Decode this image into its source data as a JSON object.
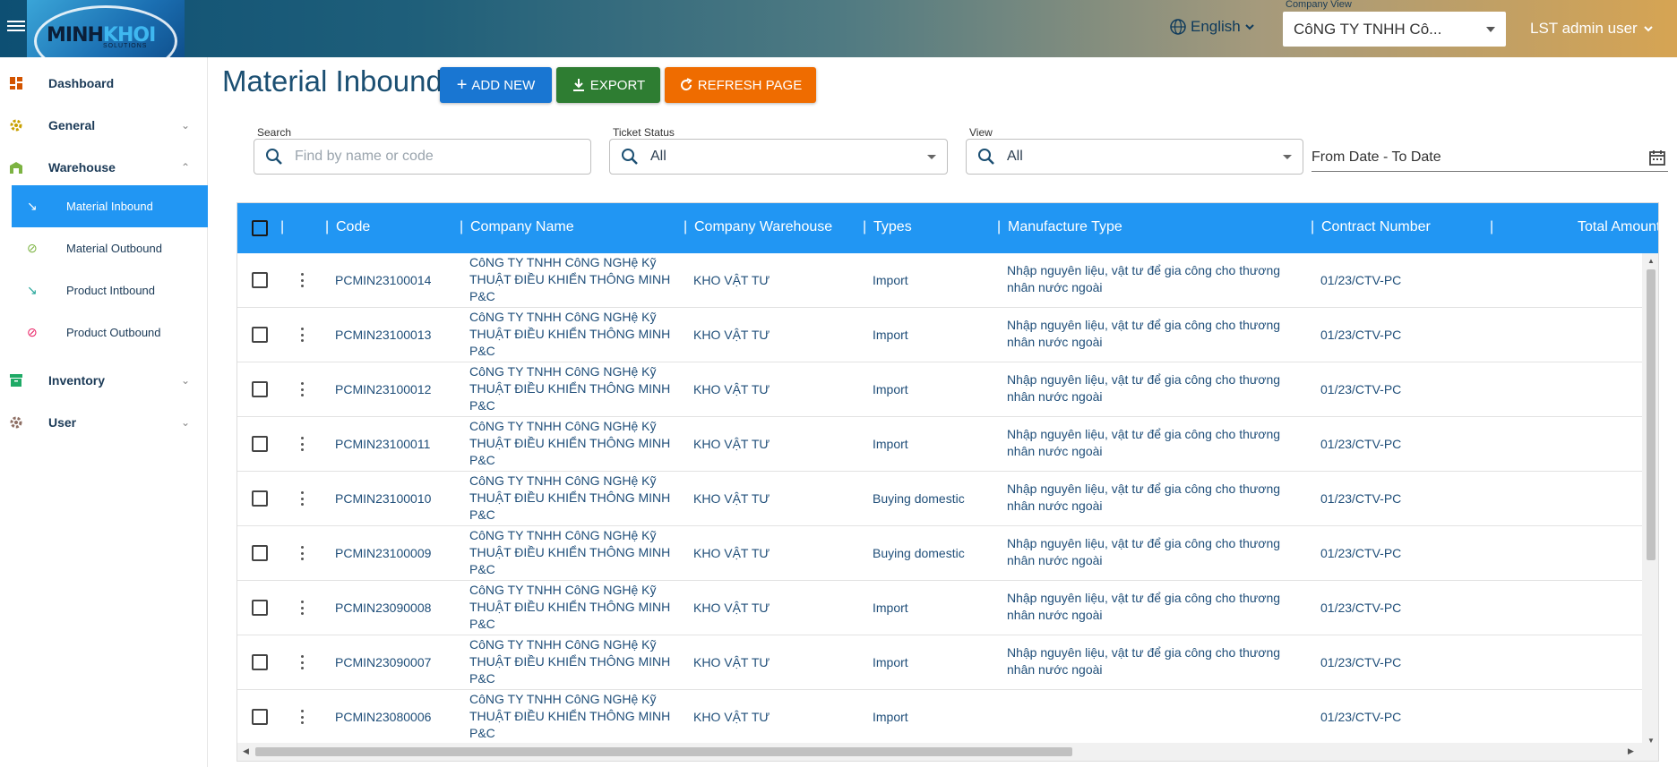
{
  "header": {
    "logo_text_a": "MINH",
    "logo_text_b": "KHOI",
    "logo_sub": "SOLUTIONS",
    "language": "English",
    "company_label": "Company View",
    "company_value": "CôNG TY TNHH Cô...",
    "user": "LST admin user"
  },
  "sidebar": {
    "items": [
      {
        "label": "Dashboard",
        "icon": "dashboard-icon"
      },
      {
        "label": "General",
        "icon": "gear-icon"
      },
      {
        "label": "Warehouse",
        "icon": "warehouse-icon"
      },
      {
        "label": "Inventory",
        "icon": "inventory-icon"
      },
      {
        "label": "User",
        "icon": "gear-icon"
      }
    ],
    "warehouse_sub": [
      {
        "label": "Material Inbound",
        "icon": "arrow-inbound-icon"
      },
      {
        "label": "Material Outbound",
        "icon": "arrow-outbound-icon"
      },
      {
        "label": "Product Intbound",
        "icon": "arrow-inbound-icon"
      },
      {
        "label": "Product Outbound",
        "icon": "arrow-outbound-icon"
      }
    ]
  },
  "page": {
    "title": "Material Inbound",
    "add_new": "ADD NEW",
    "export": "EXPORT",
    "refresh": "REFRESH PAGE"
  },
  "filters": {
    "search_label": "Search",
    "search_placeholder": "Find by name or code",
    "status_label": "Ticket Status",
    "status_value": "All",
    "view_label": "View",
    "view_value": "All",
    "date_range": "From Date - To Date"
  },
  "table": {
    "columns": [
      "Code",
      "Company Name",
      "Company Warehouse",
      "Types",
      "Manufacture Type",
      "Contract Number",
      "Total Amount"
    ],
    "rows": [
      {
        "code": "PCMIN23100014",
        "company": "CôNG TY TNHH CôNG NGHệ Kỹ THUẬT ĐIỀU KHIỂN THÔNG MINH P&C",
        "warehouse": "KHO VẬT TƯ",
        "type": "Import",
        "manufacture": "Nhập nguyên liệu, vật tư để gia công cho thương nhân nước ngoài",
        "contract": "01/23/CTV-PC"
      },
      {
        "code": "PCMIN23100013",
        "company": "CôNG TY TNHH CôNG NGHệ Kỹ THUẬT ĐIỀU KHIỂN THÔNG MINH P&C",
        "warehouse": "KHO VẬT TƯ",
        "type": "Import",
        "manufacture": "Nhập nguyên liệu, vật tư để gia công cho thương nhân nước ngoài",
        "contract": "01/23/CTV-PC"
      },
      {
        "code": "PCMIN23100012",
        "company": "CôNG TY TNHH CôNG NGHệ Kỹ THUẬT ĐIỀU KHIỂN THÔNG MINH P&C",
        "warehouse": "KHO VẬT TƯ",
        "type": "Import",
        "manufacture": "Nhập nguyên liệu, vật tư để gia công cho thương nhân nước ngoài",
        "contract": "01/23/CTV-PC"
      },
      {
        "code": "PCMIN23100011",
        "company": "CôNG TY TNHH CôNG NGHệ Kỹ THUẬT ĐIỀU KHIỂN THÔNG MINH P&C",
        "warehouse": "KHO VẬT TƯ",
        "type": "Import",
        "manufacture": "Nhập nguyên liệu, vật tư để gia công cho thương nhân nước ngoài",
        "contract": "01/23/CTV-PC"
      },
      {
        "code": "PCMIN23100010",
        "company": "CôNG TY TNHH CôNG NGHệ Kỹ THUẬT ĐIỀU KHIỂN THÔNG MINH P&C",
        "warehouse": "KHO VẬT TƯ",
        "type": "Buying domestic",
        "manufacture": "Nhập nguyên liệu, vật tư để gia công cho thương nhân nước ngoài",
        "contract": "01/23/CTV-PC"
      },
      {
        "code": "PCMIN23100009",
        "company": "CôNG TY TNHH CôNG NGHệ Kỹ THUẬT ĐIỀU KHIỂN THÔNG MINH P&C",
        "warehouse": "KHO VẬT TƯ",
        "type": "Buying domestic",
        "manufacture": "Nhập nguyên liệu, vật tư để gia công cho thương nhân nước ngoài",
        "contract": "01/23/CTV-PC"
      },
      {
        "code": "PCMIN23090008",
        "company": "CôNG TY TNHH CôNG NGHệ Kỹ THUẬT ĐIỀU KHIỂN THÔNG MINH P&C",
        "warehouse": "KHO VẬT TƯ",
        "type": "Import",
        "manufacture": "Nhập nguyên liệu, vật tư để gia công cho thương nhân nước ngoài",
        "contract": "01/23/CTV-PC"
      },
      {
        "code": "PCMIN23090007",
        "company": "CôNG TY TNHH CôNG NGHệ Kỹ THUẬT ĐIỀU KHIỂN THÔNG MINH P&C",
        "warehouse": "KHO VẬT TƯ",
        "type": "Import",
        "manufacture": "Nhập nguyên liệu, vật tư để gia công cho thương nhân nước ngoài",
        "contract": "01/23/CTV-PC"
      },
      {
        "code": "PCMIN23080006",
        "company": "CôNG TY TNHH CôNG NGHệ Kỹ THUẬT ĐIỀU KHIỂN THÔNG MINH P&C",
        "warehouse": "KHO VẬT TƯ",
        "type": "Import",
        "manufacture": "",
        "contract": "01/23/CTV-PC"
      }
    ]
  },
  "colors": {
    "primary": "#2196f3",
    "add": "#1976d2",
    "export": "#2e7d32",
    "refresh": "#ef6c00"
  }
}
